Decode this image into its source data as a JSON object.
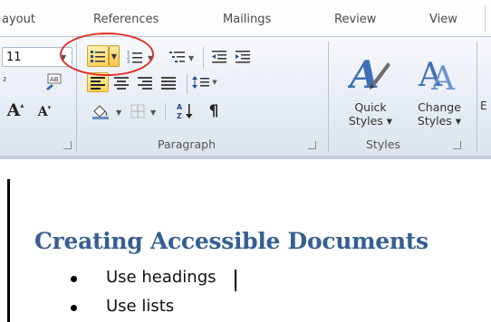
{
  "tabs": {
    "layout": "ayout",
    "references": "References",
    "mailings": "Mailings",
    "review": "Review",
    "view": "View"
  },
  "font_group": {
    "size_value": "11",
    "superscript_glyph": "²",
    "grow_font": "A",
    "shrink_font": "A"
  },
  "paragraph_group": {
    "label": "Paragraph",
    "sort_glyph": "A↓Z",
    "pilcrow": "¶"
  },
  "styles_group": {
    "label": "Styles",
    "quick_styles_line1": "Quick",
    "quick_styles_line2": "Styles",
    "change_styles_line1": "Change",
    "change_styles_line2": "Styles",
    "edit_partial": "E"
  },
  "document": {
    "heading": "Creating Accessible Documents",
    "bullets": [
      "Use headings",
      "Use lists"
    ]
  },
  "colors": {
    "heading": "#365f91",
    "highlight": "#fcd35b",
    "annotation_ellipse": "#e0302a"
  }
}
